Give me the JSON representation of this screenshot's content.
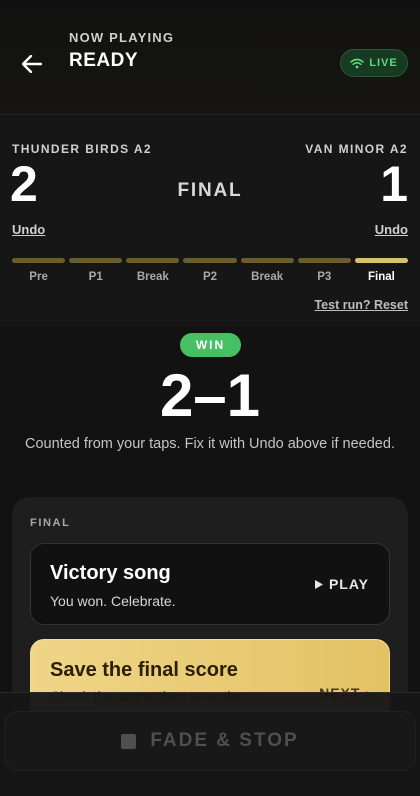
{
  "header": {
    "now_label": "NOW PLAYING",
    "title": "READY",
    "live_label": "LIVE"
  },
  "scoreboard": {
    "home": {
      "name": "THUNDER BIRDS A2",
      "score": "2",
      "undo": "Undo"
    },
    "away": {
      "name": "VAN MINOR A2",
      "score": "1",
      "undo": "Undo"
    },
    "current_period": "FINAL",
    "periods": [
      {
        "label": "Pre"
      },
      {
        "label": "P1"
      },
      {
        "label": "Break"
      },
      {
        "label": "P2"
      },
      {
        "label": "Break"
      },
      {
        "label": "P3"
      },
      {
        "label": "Final"
      }
    ],
    "active_period_index": 6,
    "reset_link": "Test run? Reset"
  },
  "result": {
    "badge": "WIN",
    "score": "2–1",
    "note": "Counted from your taps. Fix it with Undo above if needed."
  },
  "panel": {
    "label": "FINAL",
    "song": {
      "title": "Victory song",
      "subtitle": "You won. Celebrate.",
      "action": "PLAY"
    },
    "save": {
      "title": "Save the final score",
      "subtitle": "Check the score, then save the",
      "action": "NEXT"
    }
  },
  "bottom": {
    "button": "FADE & STOP"
  },
  "colors": {
    "accent_gold": "#e3c264",
    "live_green": "#62d87c",
    "win_green": "#46c062"
  }
}
